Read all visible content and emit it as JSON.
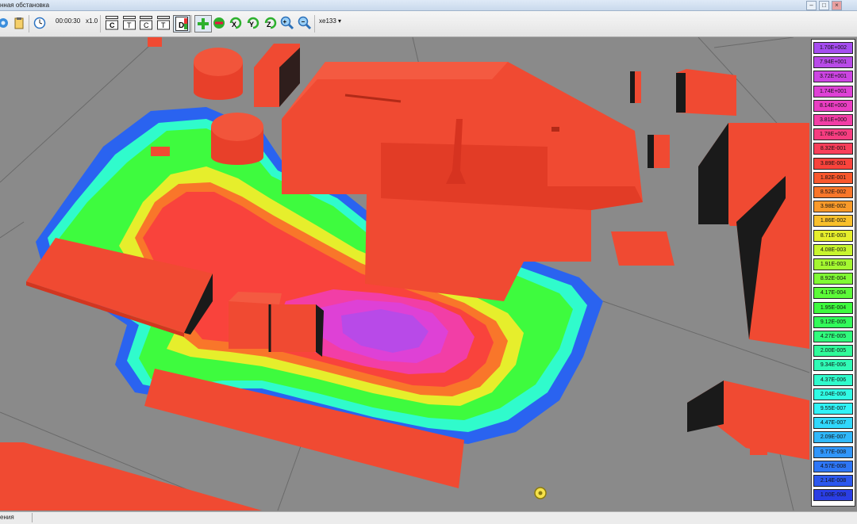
{
  "window": {
    "title": "нная обстановка"
  },
  "toolbar": {
    "time": "00:00:30",
    "speed": "x1.0",
    "zoom_select": "xe133",
    "buttons": [
      {
        "name": "settings-icon",
        "glyph": "⚙"
      },
      {
        "name": "clipboard-icon",
        "glyph": "📋"
      },
      {
        "name": "clock-icon",
        "glyph": "◷"
      },
      {
        "name": "tool-c-button",
        "glyph": "C"
      },
      {
        "name": "tool-t-button",
        "glyph": "T"
      },
      {
        "name": "tool-c2-button",
        "glyph": "C"
      },
      {
        "name": "tool-t2-button",
        "glyph": "T"
      },
      {
        "name": "tool-d-button",
        "glyph": "D"
      },
      {
        "name": "add-button",
        "glyph": "+"
      },
      {
        "name": "remove-button",
        "glyph": "−"
      },
      {
        "name": "rotate-x-button",
        "glyph": "X"
      },
      {
        "name": "rotate-y-button",
        "glyph": "Y"
      },
      {
        "name": "rotate-z-button",
        "glyph": "Z"
      },
      {
        "name": "zoom-in-button",
        "glyph": "+"
      },
      {
        "name": "zoom-out-button",
        "glyph": "−"
      }
    ]
  },
  "legend": {
    "items": [
      {
        "label": "1.70E+002",
        "color": "#a64df0"
      },
      {
        "label": "7.94E+001",
        "color": "#b84ae8"
      },
      {
        "label": "3.72E+001",
        "color": "#cc45e2"
      },
      {
        "label": "1.74E+001",
        "color": "#de41d6"
      },
      {
        "label": "8.14E+000",
        "color": "#ea3ec2"
      },
      {
        "label": "3.81E+000",
        "color": "#f23ea6"
      },
      {
        "label": "1.78E+000",
        "color": "#f73d80"
      },
      {
        "label": "8.32E-001",
        "color": "#f93f5a"
      },
      {
        "label": "3.89E-001",
        "color": "#f9433c"
      },
      {
        "label": "1.82E-001",
        "color": "#f9582c"
      },
      {
        "label": "8.52E-002",
        "color": "#f9762a"
      },
      {
        "label": "3.98E-002",
        "color": "#f99a2a"
      },
      {
        "label": "1.86E-002",
        "color": "#f9c02c"
      },
      {
        "label": "8.71E-003",
        "color": "#e6ee2c"
      },
      {
        "label": "4.08E-003",
        "color": "#c8f52e"
      },
      {
        "label": "1.91E-003",
        "color": "#a4f830"
      },
      {
        "label": "8.92E-004",
        "color": "#80fb34"
      },
      {
        "label": "4.17E-004",
        "color": "#5cfb38"
      },
      {
        "label": "1.95E-004",
        "color": "#3efb3e"
      },
      {
        "label": "9.12E-005",
        "color": "#32fb5a"
      },
      {
        "label": "4.27E-005",
        "color": "#30fb7c"
      },
      {
        "label": "2.00E-005",
        "color": "#30fb9a"
      },
      {
        "label": "9.34E-006",
        "color": "#30fbb6"
      },
      {
        "label": "4.37E-006",
        "color": "#30fbcc"
      },
      {
        "label": "2.04E-006",
        "color": "#30fbe4"
      },
      {
        "label": "9.55E-007",
        "color": "#30f3f8"
      },
      {
        "label": "4.47E-007",
        "color": "#30d8fb"
      },
      {
        "label": "2.09E-007",
        "color": "#30b8fb"
      },
      {
        "label": "9.77E-008",
        "color": "#3096fb"
      },
      {
        "label": "4.57E-008",
        "color": "#2e76f6"
      },
      {
        "label": "2.14E-008",
        "color": "#2c58ee"
      },
      {
        "label": "1.00E-008",
        "color": "#2a3ee4"
      }
    ]
  },
  "status": {
    "text": "ения"
  },
  "colors": {
    "building": "#f04a32",
    "building_shadow": "#1a1a1a",
    "ground": "#8a8a8a",
    "toolbar": "#eeeeee"
  }
}
